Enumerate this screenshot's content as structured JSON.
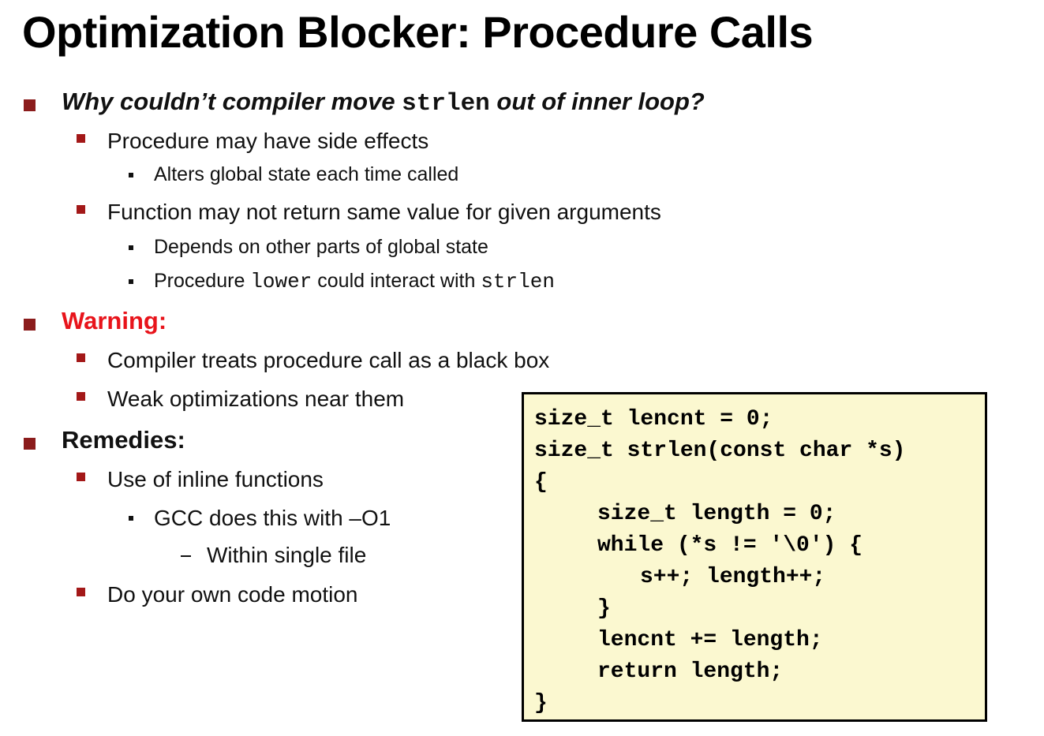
{
  "title": "Optimization Blocker: Procedure Calls",
  "q": {
    "pre": "Why couldn’t compiler move ",
    "code": "strlen",
    "post": " out of  inner loop?"
  },
  "side_effects": "Procedure may have side effects",
  "alters": "Alters global state each time called",
  "not_same": "Function may not return same value for given arguments",
  "depends": "Depends on other parts of global state",
  "interact": {
    "pre": "Procedure ",
    "code1": "lower",
    "mid": " could interact with ",
    "code2": "strlen"
  },
  "warning": "Warning:",
  "black_box": "Compiler treats procedure call as a black box",
  "weak": "Weak optimizations near them",
  "remedies": "Remedies:",
  "inline": "Use of inline functions",
  "gcc": "GCC does this with –O1",
  "within": "Within single file",
  "motion": "Do your own code motion",
  "code": {
    "l1": "size_t lencnt = 0;",
    "l2": "size_t strlen(const char *s)",
    "l3": "{",
    "l4": "size_t length = 0;",
    "l5": "while (*s != '\\0') {",
    "l6": "s++; length++;",
    "l7": "}",
    "l8": "lencnt += length;",
    "l9": "return length;",
    "l10": "}"
  },
  "colors": {
    "bullet_l1": "#8b1c1c",
    "bullet_l2": "#a31818",
    "warning": "#e8141b",
    "code_bg": "#fbf8d0"
  }
}
